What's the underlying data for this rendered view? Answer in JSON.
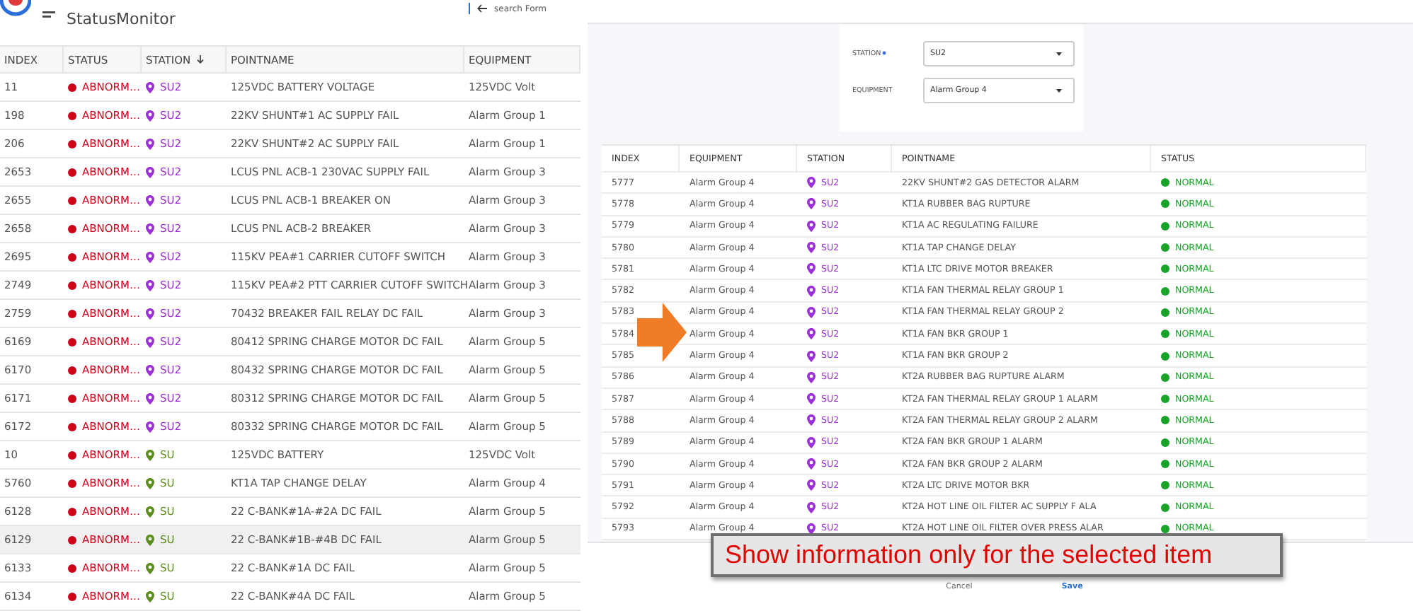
{
  "app": {
    "title": "StatusMonitor",
    "back_link": "search Form"
  },
  "status_table": {
    "columns": [
      "INDEX",
      "STATUS",
      "STATION",
      "POINTNAME",
      "EQUIPMENT"
    ],
    "rows": [
      {
        "index": "11",
        "status": {
          "text": "ABNORM…",
          "color": "#d0021b"
        },
        "station": {
          "text": "SU2",
          "color": "#9b30d9"
        },
        "pointname": "125VDC BATTERY VOLTAGE",
        "equipment": "125VDC Volt",
        "selected": false
      },
      {
        "index": "198",
        "status": {
          "text": "ABNORM…",
          "color": "#d0021b"
        },
        "station": {
          "text": "SU2",
          "color": "#9b30d9"
        },
        "pointname": "22KV SHUNT#1 AC SUPPLY FAIL",
        "equipment": "Alarm Group 1",
        "selected": false
      },
      {
        "index": "206",
        "status": {
          "text": "ABNORM…",
          "color": "#d0021b"
        },
        "station": {
          "text": "SU2",
          "color": "#9b30d9"
        },
        "pointname": "22KV SHUNT#2 AC SUPPLY FAIL",
        "equipment": "Alarm Group 1",
        "selected": false
      },
      {
        "index": "2653",
        "status": {
          "text": "ABNORM…",
          "color": "#d0021b"
        },
        "station": {
          "text": "SU2",
          "color": "#9b30d9"
        },
        "pointname": "LCUS PNL ACB-1 230VAC SUPPLY FAIL",
        "equipment": "Alarm Group 3",
        "selected": false
      },
      {
        "index": "2655",
        "status": {
          "text": "ABNORM…",
          "color": "#d0021b"
        },
        "station": {
          "text": "SU2",
          "color": "#9b30d9"
        },
        "pointname": "LCUS PNL ACB-1 BREAKER ON",
        "equipment": "Alarm Group 3",
        "selected": false
      },
      {
        "index": "2658",
        "status": {
          "text": "ABNORM…",
          "color": "#d0021b"
        },
        "station": {
          "text": "SU2",
          "color": "#9b30d9"
        },
        "pointname": "LCUS PNL ACB-2 BREAKER",
        "equipment": "Alarm Group 3",
        "selected": false
      },
      {
        "index": "2695",
        "status": {
          "text": "ABNORM…",
          "color": "#d0021b"
        },
        "station": {
          "text": "SU2",
          "color": "#9b30d9"
        },
        "pointname": "115KV PEA#1 CARRIER CUTOFF SWITCH",
        "equipment": "Alarm Group 3",
        "selected": false
      },
      {
        "index": "2749",
        "status": {
          "text": "ABNORM…",
          "color": "#d0021b"
        },
        "station": {
          "text": "SU2",
          "color": "#9b30d9"
        },
        "pointname": "115KV PEA#2 PTT CARRIER CUTOFF SWITCH",
        "equipment": "Alarm Group 3",
        "selected": false
      },
      {
        "index": "2759",
        "status": {
          "text": "ABNORM…",
          "color": "#d0021b"
        },
        "station": {
          "text": "SU2",
          "color": "#9b30d9"
        },
        "pointname": "70432 BREAKER FAIL RELAY DC FAIL",
        "equipment": "Alarm Group 3",
        "selected": false
      },
      {
        "index": "6169",
        "status": {
          "text": "ABNORM…",
          "color": "#d0021b"
        },
        "station": {
          "text": "SU2",
          "color": "#9b30d9"
        },
        "pointname": "80412 SPRING CHARGE MOTOR DC FAIL",
        "equipment": "Alarm Group 5",
        "selected": false
      },
      {
        "index": "6170",
        "status": {
          "text": "ABNORM…",
          "color": "#d0021b"
        },
        "station": {
          "text": "SU2",
          "color": "#9b30d9"
        },
        "pointname": "80432 SPRING CHARGE MOTOR DC FAIL",
        "equipment": "Alarm Group 5",
        "selected": false
      },
      {
        "index": "6171",
        "status": {
          "text": "ABNORM…",
          "color": "#d0021b"
        },
        "station": {
          "text": "SU2",
          "color": "#9b30d9"
        },
        "pointname": "80312 SPRING CHARGE MOTOR DC FAIL",
        "equipment": "Alarm Group 5",
        "selected": false
      },
      {
        "index": "6172",
        "status": {
          "text": "ABNORM…",
          "color": "#d0021b"
        },
        "station": {
          "text": "SU2",
          "color": "#9b30d9"
        },
        "pointname": "80332 SPRING CHARGE MOTOR DC FAIL",
        "equipment": "Alarm Group 5",
        "selected": false
      },
      {
        "index": "10",
        "status": {
          "text": "ABNORM…",
          "color": "#d0021b"
        },
        "station": {
          "text": "SU",
          "color": "#5b8c1e"
        },
        "pointname": "125VDC BATTERY",
        "equipment": "125VDC Volt",
        "selected": false
      },
      {
        "index": "5760",
        "status": {
          "text": "ABNORM…",
          "color": "#d0021b"
        },
        "station": {
          "text": "SU",
          "color": "#5b8c1e"
        },
        "pointname": "KT1A TAP CHANGE DELAY",
        "equipment": "Alarm Group 4",
        "selected": false
      },
      {
        "index": "6128",
        "status": {
          "text": "ABNORM…",
          "color": "#d0021b"
        },
        "station": {
          "text": "SU",
          "color": "#5b8c1e"
        },
        "pointname": "22 C-BANK#1A-#2A DC FAIL",
        "equipment": "Alarm Group 5",
        "selected": false
      },
      {
        "index": "6129",
        "status": {
          "text": "ABNORM…",
          "color": "#d0021b"
        },
        "station": {
          "text": "SU",
          "color": "#5b8c1e"
        },
        "pointname": "22 C-BANK#1B-#4B DC FAIL",
        "equipment": "Alarm Group 5",
        "selected": true
      },
      {
        "index": "6133",
        "status": {
          "text": "ABNORM…",
          "color": "#d0021b"
        },
        "station": {
          "text": "SU",
          "color": "#5b8c1e"
        },
        "pointname": "22 C-BANK#1A DC FAIL",
        "equipment": "Alarm Group 5",
        "selected": false
      },
      {
        "index": "6134",
        "status": {
          "text": "ABNORM…",
          "color": "#d0021b"
        },
        "station": {
          "text": "SU",
          "color": "#5b8c1e"
        },
        "pointname": "22 C-BANK#4A DC FAIL",
        "equipment": "Alarm Group 5",
        "selected": false
      }
    ]
  },
  "filter_form": {
    "fields": [
      {
        "label": "STATION",
        "required": true,
        "value": "SU2"
      },
      {
        "label": "EQUIPMENT",
        "required": false,
        "value": "Alarm Group 4"
      }
    ]
  },
  "detail_table": {
    "columns": [
      "INDEX",
      "EQUIPMENT",
      "STATION",
      "POINTNAME",
      "STATUS"
    ],
    "rows": [
      {
        "index": "5777",
        "equipment": "Alarm Group 4",
        "station": {
          "text": "SU2",
          "color": "#9b30d9"
        },
        "pointname": "22KV SHUNT#2 GAS DETECTOR ALARM",
        "status": {
          "text": "NORMAL",
          "color": "#1aa32a"
        }
      },
      {
        "index": "5778",
        "equipment": "Alarm Group 4",
        "station": {
          "text": "SU2",
          "color": "#9b30d9"
        },
        "pointname": "KT1A RUBBER BAG RUPTURE",
        "status": {
          "text": "NORMAL",
          "color": "#1aa32a"
        }
      },
      {
        "index": "5779",
        "equipment": "Alarm Group 4",
        "station": {
          "text": "SU2",
          "color": "#9b30d9"
        },
        "pointname": "KT1A AC REGULATING FAILURE",
        "status": {
          "text": "NORMAL",
          "color": "#1aa32a"
        }
      },
      {
        "index": "5780",
        "equipment": "Alarm Group 4",
        "station": {
          "text": "SU2",
          "color": "#9b30d9"
        },
        "pointname": "KT1A TAP CHANGE DELAY",
        "status": {
          "text": "NORMAL",
          "color": "#1aa32a"
        }
      },
      {
        "index": "5781",
        "equipment": "Alarm Group 4",
        "station": {
          "text": "SU2",
          "color": "#9b30d9"
        },
        "pointname": "KT1A LTC DRIVE MOTOR BREAKER",
        "status": {
          "text": "NORMAL",
          "color": "#1aa32a"
        }
      },
      {
        "index": "5782",
        "equipment": "Alarm Group 4",
        "station": {
          "text": "SU2",
          "color": "#9b30d9"
        },
        "pointname": "KT1A FAN THERMAL RELAY GROUP 1",
        "status": {
          "text": "NORMAL",
          "color": "#1aa32a"
        }
      },
      {
        "index": "5783",
        "equipment": "Alarm Group 4",
        "station": {
          "text": "SU2",
          "color": "#9b30d9"
        },
        "pointname": "KT1A FAN THERMAL RELAY GROUP 2",
        "status": {
          "text": "NORMAL",
          "color": "#1aa32a"
        }
      },
      {
        "index": "5784",
        "equipment": "Alarm Group 4",
        "station": {
          "text": "SU2",
          "color": "#9b30d9"
        },
        "pointname": "KT1A FAN BKR GROUP 1",
        "status": {
          "text": "NORMAL",
          "color": "#1aa32a"
        }
      },
      {
        "index": "5785",
        "equipment": "Alarm Group 4",
        "station": {
          "text": "SU2",
          "color": "#9b30d9"
        },
        "pointname": "KT1A FAN BKR GROUP 2",
        "status": {
          "text": "NORMAL",
          "color": "#1aa32a"
        }
      },
      {
        "index": "5786",
        "equipment": "Alarm Group 4",
        "station": {
          "text": "SU2",
          "color": "#9b30d9"
        },
        "pointname": "KT2A RUBBER BAG RUPTURE ALARM",
        "status": {
          "text": "NORMAL",
          "color": "#1aa32a"
        }
      },
      {
        "index": "5787",
        "equipment": "Alarm Group 4",
        "station": {
          "text": "SU2",
          "color": "#9b30d9"
        },
        "pointname": "KT2A FAN THERMAL RELAY GROUP 1 ALARM",
        "status": {
          "text": "NORMAL",
          "color": "#1aa32a"
        }
      },
      {
        "index": "5788",
        "equipment": "Alarm Group 4",
        "station": {
          "text": "SU2",
          "color": "#9b30d9"
        },
        "pointname": "KT2A FAN THERMAL RELAY GROUP 2 ALARM",
        "status": {
          "text": "NORMAL",
          "color": "#1aa32a"
        }
      },
      {
        "index": "5789",
        "equipment": "Alarm Group 4",
        "station": {
          "text": "SU2",
          "color": "#9b30d9"
        },
        "pointname": "KT2A FAN BKR GROUP 1 ALARM",
        "status": {
          "text": "NORMAL",
          "color": "#1aa32a"
        }
      },
      {
        "index": "5790",
        "equipment": "Alarm Group 4",
        "station": {
          "text": "SU2",
          "color": "#9b30d9"
        },
        "pointname": "KT2A FAN BKR GROUP 2 ALARM",
        "status": {
          "text": "NORMAL",
          "color": "#1aa32a"
        }
      },
      {
        "index": "5791",
        "equipment": "Alarm Group 4",
        "station": {
          "text": "SU2",
          "color": "#9b30d9"
        },
        "pointname": "KT2A LTC DRIVE MOTOR BKR",
        "status": {
          "text": "NORMAL",
          "color": "#1aa32a"
        }
      },
      {
        "index": "5792",
        "equipment": "Alarm Group 4",
        "station": {
          "text": "SU2",
          "color": "#9b30d9"
        },
        "pointname": "KT2A HOT LINE OIL FILTER AC SUPPLY F ALA",
        "status": {
          "text": "NORMAL",
          "color": "#1aa32a"
        }
      },
      {
        "index": "5793",
        "equipment": "Alarm Group 4",
        "station": {
          "text": "SU2",
          "color": "#9b30d9"
        },
        "pointname": "KT2A HOT LINE OIL FILTER OVER PRESS ALAR",
        "status": {
          "text": "NORMAL",
          "color": "#1aa32a"
        }
      }
    ]
  },
  "footer_buttons": [
    "Cancel",
    "Save"
  ],
  "callout": {
    "text": "Show information only for the selected item"
  }
}
